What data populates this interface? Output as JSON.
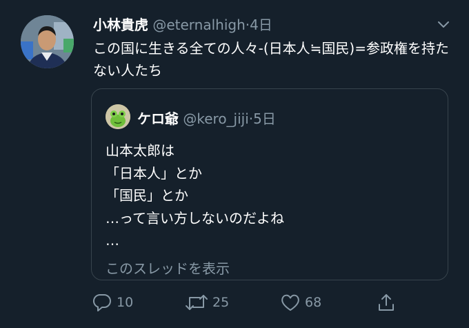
{
  "tweet": {
    "author_name": "小林貴虎",
    "author_handle": "@eternalhigh",
    "separator": "·",
    "time": "4日",
    "text": "この国に生きる全ての人々-(日本人≒国民)=参政権を持たない人たち"
  },
  "quote": {
    "author_name": "ケロ爺",
    "author_handle": "@kero_jiji",
    "separator": "·",
    "time": "5日",
    "text": "山本太郎は\n「日本人」とか\n「国民」とか\n…って言い方しないのだよね\n…",
    "show_thread": "このスレッドを表示"
  },
  "actions": {
    "replies": "10",
    "retweets": "25",
    "likes": "68"
  },
  "colors": {
    "background": "#15202b",
    "secondary_text": "#8899a6",
    "border": "#38444d"
  },
  "icons": [
    "chevron-down-icon",
    "reply-icon",
    "retweet-icon",
    "like-icon",
    "share-icon"
  ]
}
